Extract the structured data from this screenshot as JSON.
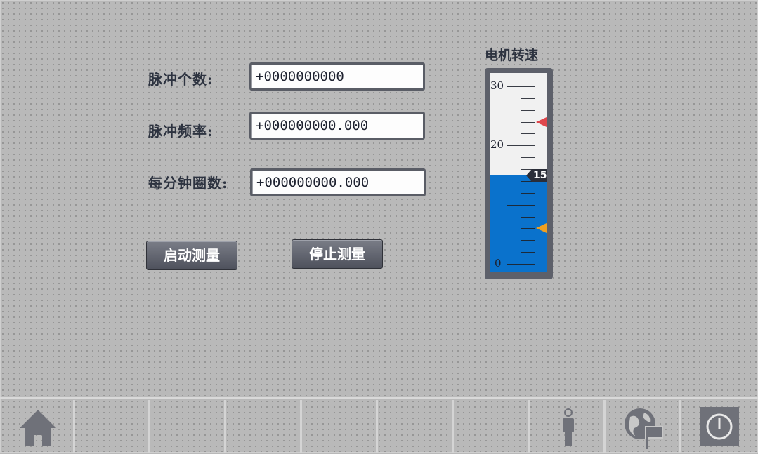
{
  "fields": [
    {
      "label": "脉冲个数:",
      "value": "+0000000000"
    },
    {
      "label": "脉冲频率:",
      "value": "+000000000.000"
    },
    {
      "label": "每分钟圈数:",
      "value": "+000000000.000"
    }
  ],
  "buttons": {
    "start": "启动测量",
    "stop": "停止测量"
  },
  "gauge": {
    "title": "电机转速",
    "min": 0,
    "max": 30,
    "tick_labels": [
      "30",
      "20",
      "0"
    ],
    "value": 15,
    "value_label": "15",
    "upper_limit_marker": 24,
    "lower_limit_marker": 6,
    "fill_color": "#0a72cc",
    "upper_marker_color": "#e0474c",
    "lower_marker_color": "#f0a020"
  },
  "taskbar": {
    "icons": [
      "home-icon",
      "user-icon",
      "language-icon",
      "power-icon"
    ]
  }
}
